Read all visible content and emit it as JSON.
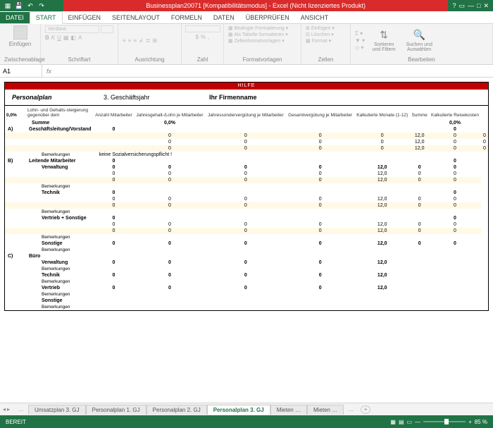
{
  "titlebar": {
    "title": "Businessplan20071 [Kompatibilitätsmodus] - Excel (Nicht lizenziertes Produkt)"
  },
  "ribbon": {
    "tabs": [
      "DATEI",
      "START",
      "EINFÜGEN",
      "SEITENLAYOUT",
      "FORMELN",
      "DATEN",
      "ÜBERPRÜFEN",
      "ANSICHT"
    ],
    "groups": {
      "clipboard": "Zwischenablage",
      "font": "Schriftart",
      "alignment": "Ausrichtung",
      "number": "Zahl",
      "styles": "Formatvorlagen",
      "cells": "Zellen",
      "editing": "Bearbeiten"
    },
    "buttons": {
      "paste": "Einfügen",
      "condfmt": "Bedingte Formatierung",
      "fmttable": "Als Tabelle formatieren",
      "cellstyles": "Zellenformatvorlagen",
      "insert": "Einfügen",
      "delete": "Löschen",
      "format": "Format",
      "sortfilter": "Sortieren und Filtern",
      "findselect": "Suchen und Auswählen"
    },
    "font_name": "Verdana"
  },
  "formula": {
    "cell": "A1",
    "fx": "fx",
    "value": ""
  },
  "doc": {
    "redstrip": "HILFE",
    "title": "Personalplan",
    "year": "3. Geschäftsjahr",
    "company": "Ihr Firmenname",
    "pct": "0,0%",
    "pctlabel": "Lohn- und Gehalts-steigerung gegenüber dem",
    "cols": [
      "Anzahl Mitarbeiter",
      "Jahresgehalt-/Lohn je Mitarbeiter",
      "Jahressondervergütung je Mitarbeiter",
      "Gesamtvergütung je Mitarbeiter",
      "Kalkulierte Monate (1-12)",
      "Summe",
      "Kalkulierte Reisekosten"
    ],
    "sumrow": {
      "label": "Summe",
      "vals": [
        "",
        "0,0%",
        "",
        "",
        "",
        "",
        "0,0%"
      ]
    },
    "bem": "Bemerkungen",
    "bemtext": "keine Sozialversicherungspflicht !",
    "sections": [
      {
        "key": "A)",
        "name": "Geschäftsleitung/Vorstand",
        "headvals": [
          "0",
          "",
          "",
          "",
          "",
          "",
          "0"
        ],
        "rows": [
          [
            "",
            "0",
            "0",
            "0",
            "0",
            "12,0",
            "0",
            "0"
          ],
          [
            "",
            "0",
            "0",
            "0",
            "0",
            "12,0",
            "0",
            "0"
          ],
          [
            "",
            "0",
            "0",
            "0",
            "0",
            "12,0",
            "0",
            "0"
          ]
        ]
      },
      {
        "key": "B)",
        "name": "Leitende Mitarbeiter",
        "headvals": [
          "0",
          "",
          "",
          "",
          "",
          "",
          "0"
        ],
        "subs": [
          {
            "name": "Verwaltung",
            "rows": [
              [
                "0",
                "0",
                "0",
                "0",
                "12,0",
                "0",
                "0"
              ],
              [
                "0",
                "0",
                "0",
                "0",
                "12,0",
                "0",
                "0"
              ],
              [
                "0",
                "0",
                "0",
                "0",
                "12,0",
                "0",
                "0"
              ]
            ]
          },
          {
            "name": "Technik",
            "rows": [
              [
                "0",
                "",
                "",
                "",
                "",
                "",
                "0"
              ],
              [
                "0",
                "0",
                "0",
                "0",
                "12,0",
                "0",
                "0"
              ],
              [
                "0",
                "0",
                "0",
                "0",
                "12,0",
                "0",
                "0"
              ]
            ]
          },
          {
            "name": "Vertrieb + Sonstige",
            "rows": [
              [
                "0",
                "",
                "",
                "",
                "",
                "",
                "0"
              ],
              [
                "0",
                "0",
                "0",
                "0",
                "12,0",
                "0",
                "0"
              ],
              [
                "0",
                "0",
                "0",
                "0",
                "12,0",
                "0",
                "0"
              ]
            ]
          },
          {
            "name": "Sonstige",
            "rows": [
              [
                "0",
                "0",
                "0",
                "0",
                "12,0",
                "0",
                "0"
              ]
            ]
          }
        ]
      },
      {
        "key": "C)",
        "name": "Büro",
        "headvals": [
          "",
          "",
          "",
          "",
          "",
          "",
          ""
        ],
        "subs": [
          {
            "name": "Verwaltung",
            "rows": [
              [
                "0",
                "0",
                "0",
                "0",
                "12,0",
                "",
                ""
              ]
            ]
          },
          {
            "name": "Technik",
            "rows": [
              [
                "0",
                "0",
                "0",
                "0",
                "12,0",
                "",
                ""
              ]
            ]
          },
          {
            "name": "Vertrieb",
            "rows": [
              [
                "0",
                "0",
                "0",
                "0",
                "12,0",
                "",
                ""
              ]
            ]
          },
          {
            "name": "Sonstige",
            "rows": [
              [
                "",
                "",
                "",
                "",
                "",
                "",
                ""
              ]
            ]
          }
        ]
      }
    ]
  },
  "sheets": {
    "list": [
      "Umsatzplan 3. GJ",
      "Personalplan 1. GJ",
      "Personalplan 2. GJ",
      "Personalplan 3. GJ",
      "Mieten …",
      "Mieten …"
    ],
    "active": 3
  },
  "status": {
    "ready": "BEREIT",
    "zoom": "85 %"
  }
}
